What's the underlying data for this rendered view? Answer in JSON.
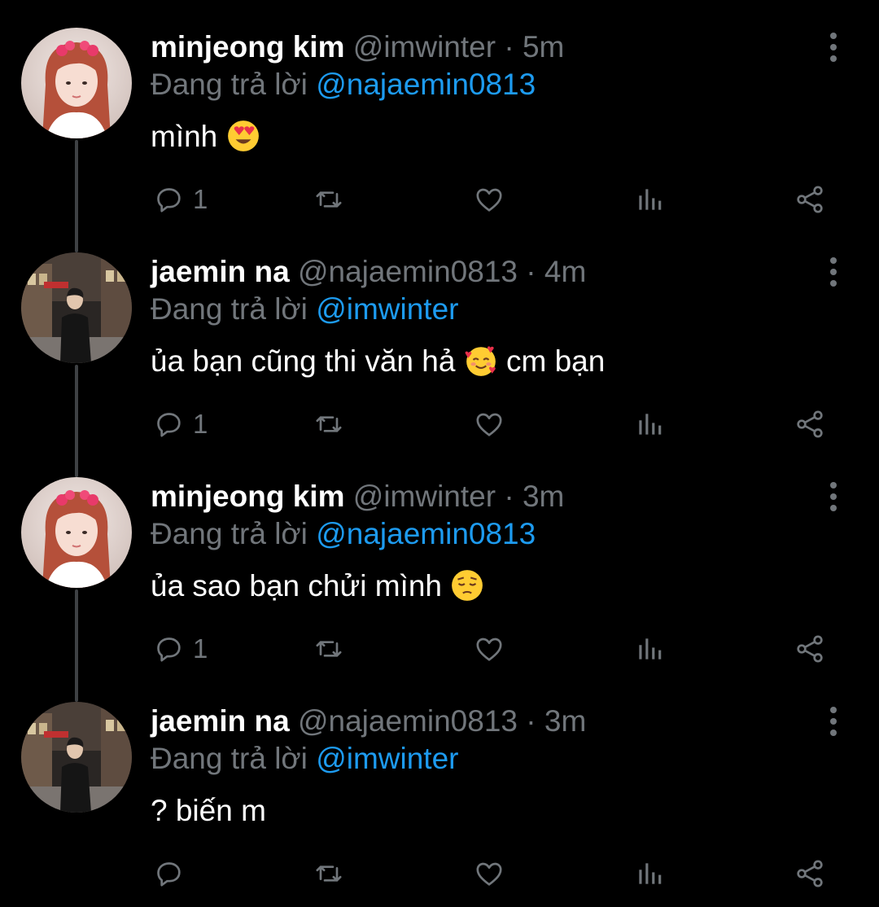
{
  "tweets": [
    {
      "display_name": "minjeong kim",
      "handle": "@imwinter",
      "separator": "·",
      "time": "5m",
      "reply_prefix": "Đang trả lời",
      "reply_to": "@najaemin0813",
      "text_before": "mình",
      "emoji": "heart-eyes-emoji",
      "text_after": "",
      "reply_count": "1",
      "avatar": "minjeong-avatar"
    },
    {
      "display_name": "jaemin na",
      "handle": "@najaemin0813",
      "separator": "·",
      "time": "4m",
      "reply_prefix": "Đang trả lời",
      "reply_to": "@imwinter",
      "text_before": "ủa bạn cũng thi văn hả",
      "emoji": "smiling-hearts-emoji",
      "text_after": "cm bạn",
      "reply_count": "1",
      "avatar": "jaemin-avatar"
    },
    {
      "display_name": "minjeong kim",
      "handle": "@imwinter",
      "separator": "·",
      "time": "3m",
      "reply_prefix": "Đang trả lời",
      "reply_to": "@najaemin0813",
      "text_before": "ủa sao bạn chửi mình",
      "emoji": "pensive-emoji",
      "text_after": "",
      "reply_count": "1",
      "avatar": "minjeong-avatar"
    },
    {
      "display_name": "jaemin na",
      "handle": "@najaemin0813",
      "separator": "·",
      "time": "3m",
      "reply_prefix": "Đang trả lời",
      "reply_to": "@imwinter",
      "text_before": "? biến m",
      "emoji": "",
      "text_after": "",
      "reply_count": "",
      "avatar": "jaemin-avatar"
    }
  ],
  "icons": {
    "reply": "reply-icon",
    "retweet": "retweet-icon",
    "like": "like-icon",
    "views": "views-icon",
    "share": "share-icon",
    "more": "more-icon"
  },
  "colors": {
    "background": "#000000",
    "primary_text": "#ffffff",
    "secondary_text": "#71767b",
    "accent": "#1d9bf0",
    "thread_line": "#3e4144"
  }
}
